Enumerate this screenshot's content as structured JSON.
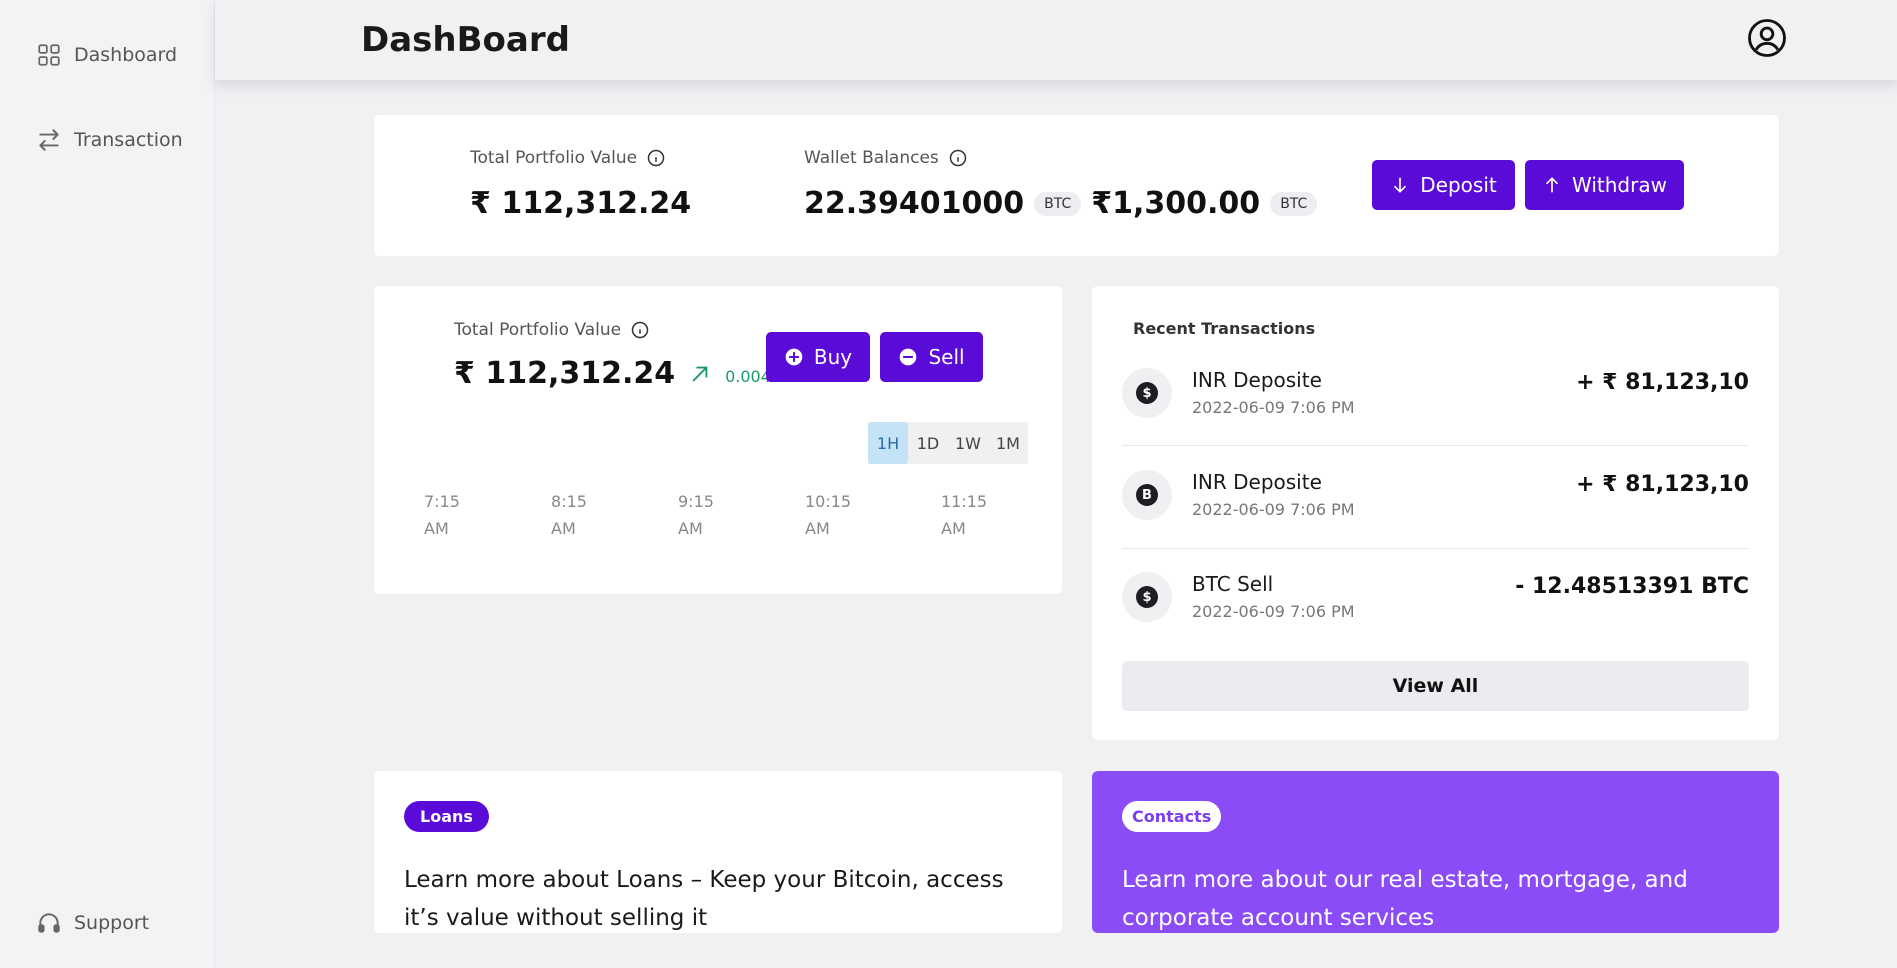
{
  "sidebar": {
    "items": [
      {
        "label": "Dashboard",
        "icon": "grid-icon"
      },
      {
        "label": "Transaction",
        "icon": "arrows-swap-icon"
      }
    ],
    "support_label": "Support"
  },
  "header": {
    "title": "DashBoard",
    "avatar_icon": "user-circle-icon"
  },
  "summary": {
    "portfolio_label": "Total Portfolio Value",
    "portfolio_value": "₹ 112,312.24",
    "wallet_label": "Wallet Balances",
    "wallet_btc_value": "22.39401000",
    "wallet_btc_unit": "BTC",
    "wallet_inr_value": "₹1,300.00",
    "wallet_inr_unit": "BTC",
    "deposit_label": "Deposit",
    "withdraw_label": "Withdraw"
  },
  "portfolio_card": {
    "label": "Total Portfolio Value",
    "value": "₹ 112,312.24",
    "change": "0.004%",
    "buy_label": "Buy",
    "sell_label": "Sell",
    "timeframes": [
      "1H",
      "1D",
      "1W",
      "1M"
    ],
    "active_timeframe": "1H",
    "time_ticks": [
      {
        "line1": "7:15",
        "line2": "AM"
      },
      {
        "line1": "8:15",
        "line2": "AM"
      },
      {
        "line1": "9:15",
        "line2": "AM"
      },
      {
        "line1": "10:15",
        "line2": "AM"
      },
      {
        "line1": "11:15",
        "line2": "AM"
      }
    ]
  },
  "recent": {
    "title": "Recent Transactions",
    "items": [
      {
        "icon_glyph": "$",
        "name": "INR Deposite",
        "date": "2022-06-09 7:06 PM",
        "amount": "+ ₹ 81,123,10"
      },
      {
        "icon_glyph": "B",
        "name": "INR Deposite",
        "date": "2022-06-09 7:06 PM",
        "amount": "+ ₹ 81,123,10"
      },
      {
        "icon_glyph": "$",
        "name": "BTC Sell",
        "date": "2022-06-09 7:06 PM",
        "amount": "- 12.48513391 BTC"
      }
    ],
    "view_all_label": "View All"
  },
  "loans": {
    "badge": "Loans",
    "text": "Learn more about Loans – Keep your Bitcoin, access it’s value without selling it"
  },
  "contacts": {
    "badge": "Contacts",
    "text": "Learn more about our real estate, mortgage, and corporate account services"
  },
  "colors": {
    "accent": "#5b0bd8",
    "contacts_bg": "#8b4cf7",
    "positive": "#1a9a6c"
  }
}
